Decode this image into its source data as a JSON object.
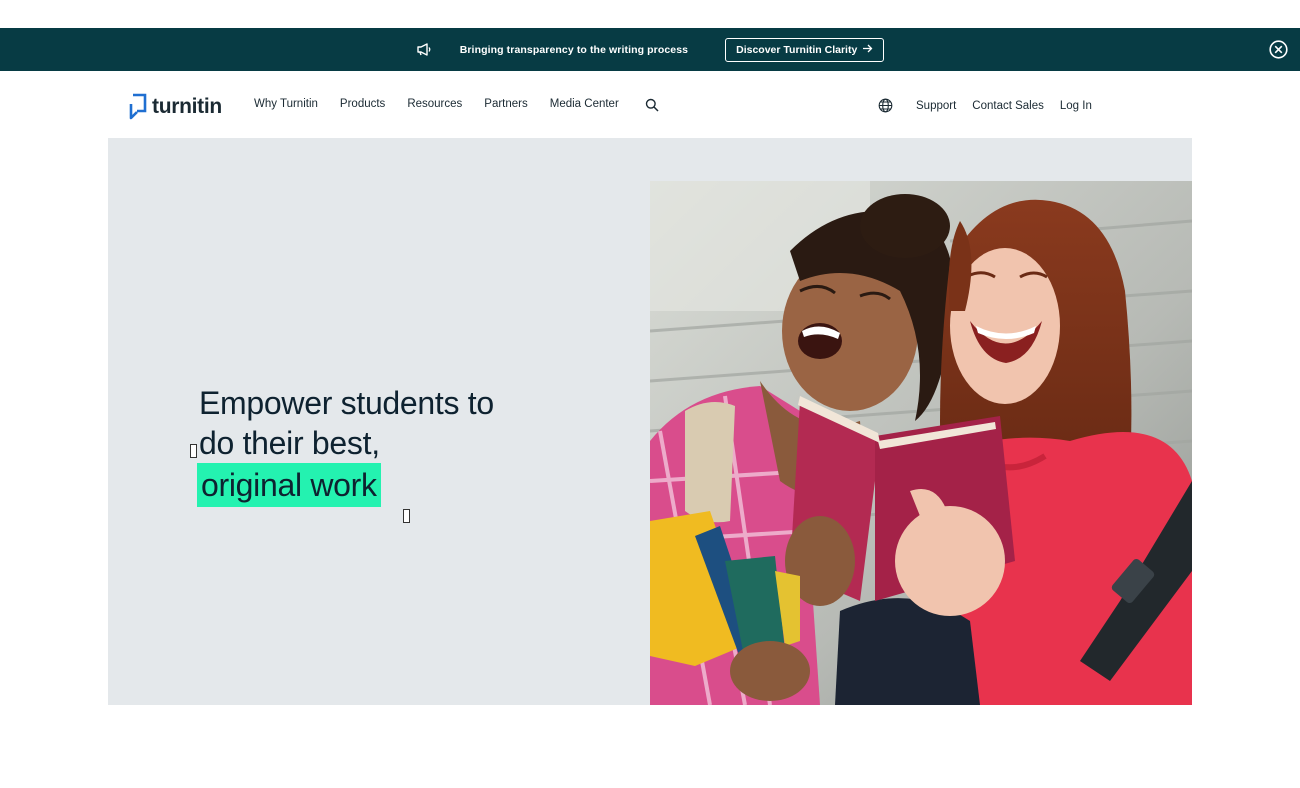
{
  "announcement": {
    "icon": "megaphone-icon",
    "text": "Bringing transparency to the writing process",
    "cta_label": "Discover Turnitin Clarity",
    "cta_icon": "arrow-right-icon",
    "close_icon": "close-circle-icon",
    "bg_color": "#073b44"
  },
  "nav": {
    "logo_text": "turnitin",
    "links": [
      "Why Turnitin",
      "Products",
      "Resources",
      "Partners",
      "Media Center"
    ],
    "search_icon": "search-icon",
    "globe_icon": "globe-icon",
    "right_links": [
      "Support",
      "Contact Sales",
      "Log In"
    ]
  },
  "hero": {
    "heading_line1": "Empower students to",
    "heading_line2": "do their best,",
    "heading_highlight": "original work",
    "highlight_color": "#24f2b0",
    "bg_color": "#e4e8eb",
    "image": "two laughing students reading a red book"
  }
}
